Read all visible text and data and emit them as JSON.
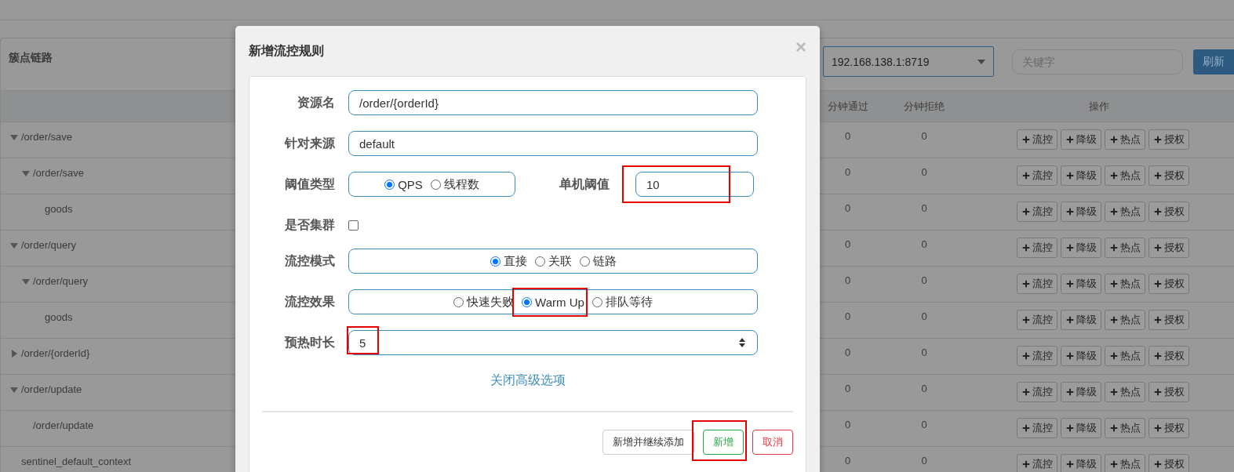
{
  "page": {
    "panel_title": "簇点链路",
    "machine_select": {
      "value": "192.168.138.1:8719"
    },
    "search": {
      "placeholder": "关键字"
    },
    "refresh_button": "刷新"
  },
  "table": {
    "columns": [
      "分钟通过",
      "分钟拒绝",
      "操作"
    ],
    "rows": [
      {
        "resource": "/order/save",
        "expanded": true,
        "pass": "0",
        "block": "0",
        "actions": [
          "流控",
          "降级",
          "热点",
          "授权"
        ],
        "children": [
          {
            "resource": "/order/save",
            "expanded": true,
            "pass": "0",
            "block": "0",
            "actions": [
              "流控",
              "降级",
              "热点",
              "授权"
            ],
            "children": [
              {
                "resource": "goods",
                "pass": "0",
                "block": "0",
                "actions": [
                  "流控",
                  "降级",
                  "热点",
                  "授权"
                ]
              }
            ]
          }
        ]
      },
      {
        "resource": "/order/query",
        "expanded": true,
        "pass": "0",
        "block": "0",
        "actions": [
          "流控",
          "降级",
          "热点",
          "授权"
        ],
        "children": [
          {
            "resource": "/order/query",
            "expanded": true,
            "pass": "0",
            "block": "0",
            "actions": [
              "流控",
              "降级",
              "热点",
              "授权"
            ],
            "children": [
              {
                "resource": "goods",
                "pass": "0",
                "block": "0",
                "actions": [
                  "流控",
                  "降级",
                  "热点",
                  "授权"
                ]
              }
            ]
          }
        ]
      },
      {
        "resource": "/order/{orderId}",
        "expanded": false,
        "pass": "0",
        "block": "0",
        "actions": [
          "流控",
          "降级",
          "热点",
          "授权"
        ]
      },
      {
        "resource": "/order/update",
        "expanded": true,
        "pass": "0",
        "block": "0",
        "actions": [
          "流控",
          "降级",
          "热点",
          "授权"
        ],
        "children": [
          {
            "resource": "/order/update",
            "pass": "0",
            "block": "0",
            "actions": [
              "流控",
              "降级",
              "热点",
              "授权"
            ]
          }
        ]
      },
      {
        "resource": "sentinel_default_context",
        "pass": "0",
        "block": "0",
        "actions": [
          "流控",
          "降级",
          "热点",
          "授权"
        ]
      }
    ]
  },
  "dialog": {
    "title": "新增流控规则",
    "close": "×",
    "fields": [
      {
        "kind": "text",
        "label": "资源名",
        "value": "/order/{orderId}"
      },
      {
        "kind": "text",
        "label": "针对来源",
        "value": "default"
      },
      {
        "kind": "radio_with_input",
        "label": "阈值类型",
        "options": [
          {
            "label": "QPS",
            "selected": true
          },
          {
            "label": "线程数",
            "selected": false
          }
        ],
        "side_label": "单机阈值",
        "side_value": "10",
        "side_highlighted": true
      },
      {
        "kind": "checkbox",
        "label": "是否集群",
        "checked": false
      },
      {
        "kind": "radio",
        "label": "流控模式",
        "options": [
          {
            "label": "直接",
            "selected": true
          },
          {
            "label": "关联",
            "selected": false
          },
          {
            "label": "链路",
            "selected": false
          }
        ]
      },
      {
        "kind": "radio",
        "label": "流控效果",
        "options": [
          {
            "label": "快速失败",
            "selected": false
          },
          {
            "label": "Warm Up",
            "selected": true,
            "highlighted": true
          },
          {
            "label": "排队等待",
            "selected": false
          }
        ]
      },
      {
        "kind": "number",
        "label": "预热时长",
        "value": "5",
        "highlighted": true
      }
    ],
    "advanced_link": "关闭高级选项",
    "buttons": [
      {
        "label": "新增并继续添加",
        "kind": "default"
      },
      {
        "label": "新增",
        "kind": "success",
        "highlighted": true
      },
      {
        "label": "取消",
        "kind": "danger"
      }
    ]
  }
}
